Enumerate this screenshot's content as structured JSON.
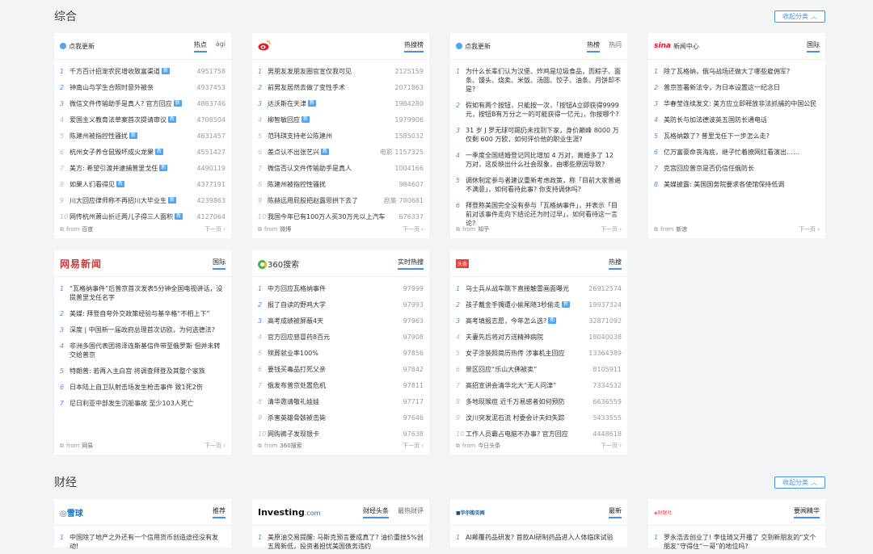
{
  "sections": {
    "zonghe": {
      "title": "综合",
      "collapse": "收起分类"
    },
    "caijing": {
      "title": "财经",
      "collapse": "收起分类"
    }
  },
  "common": {
    "from": "from",
    "next": "下一页",
    "new": "新"
  },
  "cards": {
    "c1": {
      "brand": "点我更新",
      "tabs": [
        "热点",
        "ági"
      ],
      "source": "百度",
      "items": [
        {
          "i": "1",
          "t": "千方百计招宠农民增收致富渠道",
          "new": true,
          "v": "4951758"
        },
        {
          "i": "2",
          "t": "钟南山与学生合照时意外被亲",
          "new": false,
          "v": "4937453"
        },
        {
          "i": "3",
          "t": "微信文件传输助手是真人? 官方回应",
          "new": true,
          "v": "4883746"
        },
        {
          "i": "4",
          "t": "爱国主义教育法草案首次提请审议",
          "new": true,
          "v": "4708504"
        },
        {
          "i": "5",
          "t": "陈建州被指控性骚扰",
          "new": true,
          "v": "4631457"
        },
        {
          "i": "6",
          "t": "杭州女子养仓鼠毁坏成火龙果",
          "new": true,
          "v": "4551427"
        },
        {
          "i": "7",
          "t": "美方: 希望引渡并逮捕普里戈任",
          "new": true,
          "v": "4490119"
        },
        {
          "i": "8",
          "t": "如果人们看得见",
          "new": true,
          "v": "4377191"
        },
        {
          "i": "9",
          "t": "川大回应律师称不再招川大毕业生",
          "new": true,
          "v": "4239863"
        },
        {
          "i": "10",
          "t": "网传杭州萧山折迁两儿子得三人面积",
          "new": true,
          "v": "4127064"
        }
      ]
    },
    "c2": {
      "brand": "",
      "tabs": [
        "热搜榜"
      ],
      "source": "微博",
      "items": [
        {
          "i": "1",
          "t": "男朋友发朋友圈官宣仅我可见",
          "new": false,
          "v": "2125159"
        },
        {
          "i": "2",
          "t": "前男友居然去做了变性手术",
          "new": false,
          "v": "2071863"
        },
        {
          "i": "3",
          "t": "达沃斯在天津",
          "new": true,
          "v": "1984280"
        },
        {
          "i": "4",
          "t": "柳智敏回应",
          "new": true,
          "v": "1979906"
        },
        {
          "i": "5",
          "t": "范玮琪支持老公陈建州",
          "new": false,
          "v": "1585032"
        },
        {
          "i": "6",
          "t": "差点认不出张艺兴",
          "new": true,
          "v": "电影 1157325"
        },
        {
          "i": "7",
          "t": "微信否认文件传输助手是真人",
          "new": false,
          "v": "1004166"
        },
        {
          "i": "8",
          "t": "陈建州被指控性骚扰",
          "new": false,
          "v": "984607"
        },
        {
          "i": "9",
          "t": "陈赫远用屁股把赵露思拱下去了",
          "new": false,
          "v": "剧集 780681"
        },
        {
          "i": "10",
          "t": "我国今年已有100万人买30万元以上汽车",
          "new": false,
          "v": "676337"
        }
      ]
    },
    "c3": {
      "brand": "点我更新",
      "tabs": [
        "热榜",
        "热问"
      ],
      "source": "知乎",
      "items": [
        {
          "i": "1",
          "t": "为什么长辈们认为汉堡、炸鸡是垃圾食品，而粽子、面条、馒头、烧卖、米饭、汤圆、饺子、油条、月饼却不是?"
        },
        {
          "i": "2",
          "t": "假如有两个按钮，只能按一次，「按钮A立即获得9999元，按钮B有万分之一的可能获得一亿元」，你按哪个?"
        },
        {
          "i": "3",
          "t": "31 岁 J 罗无球可踢仍未找到下家，身价巅峰 8000 万仅剩 600 万欧，如何评价他的职业生涯?"
        },
        {
          "i": "4",
          "t": "一季度全国结婚登记同比增加 4 万对，离婚多了 12 万对，这反映出什么社会现象，由哪些原因导致?"
        },
        {
          "i": "5",
          "t": "调休制定参与者建议重新考虑政策，称「目前大家普遍不满意」，如何看待此事? 你支持调休吗?"
        },
        {
          "i": "6",
          "t": "拜登称美国完全没有参与「瓦格纳事件」，并表示「目前对该事件走向下结论还为时过早」，如何看待这一言论?"
        }
      ]
    },
    "c4": {
      "brand": "新闻中心",
      "tabs": [
        "国际"
      ],
      "source": "新浪",
      "items": [
        {
          "i": "1",
          "t": "除了瓦格纳，俄乌战场还做大了哪些雇佣军?"
        },
        {
          "i": "2",
          "t": "普京签署新法令，为日本设置这一纪念日"
        },
        {
          "i": "3",
          "t": "华春莹连续发文: 美方应立即释放非法抓捕的中国公民"
        },
        {
          "i": "4",
          "t": "美防长与加法德波英五国防长通电话"
        },
        {
          "i": "5",
          "t": "瓦格纳散了? 普里戈任下一步怎么走?"
        },
        {
          "i": "6",
          "t": "亿万富豪命丧海底，继子忙着撩网红看演出……"
        },
        {
          "i": "7",
          "t": "克宫回应普京是否仍信任俄防长"
        },
        {
          "i": "8",
          "t": "美媒披露: 美国国务院要求各使馆保持低调"
        }
      ]
    },
    "c5": {
      "brand": "网易新闻",
      "tabs": [
        "国际"
      ],
      "source": "网易",
      "items": [
        {
          "i": "1",
          "t": "“瓦格纳事件”后普京首次发表5分钟全国电视讲话，没提普里戈任名字"
        },
        {
          "i": "2",
          "t": "美媒: 拜登自夸外交政策经验与基辛格“不相上下”"
        },
        {
          "i": "3",
          "t": "深度 | 中国新一届政府总理首次访欧，为何选德法?"
        },
        {
          "i": "4",
          "t": "非洲多国代表团将泽连斯基信件带至俄罗斯 但并未转交给普京"
        },
        {
          "i": "5",
          "t": "特朗普: 若再入主白宫 将调查拜登及其整个家族"
        },
        {
          "i": "6",
          "t": "日本陆上自卫队射击场发生枪击事件 致1死2伤"
        },
        {
          "i": "7",
          "t": "尼日利亚中部发生沉船事故 至少103人死亡"
        }
      ]
    },
    "c6": {
      "brand": "360搜索",
      "tabs": [
        "实时热搜"
      ],
      "source": "360搜索",
      "items": [
        {
          "i": "1",
          "t": "中方回应瓦格纳事件",
          "v": "97999"
        },
        {
          "i": "2",
          "t": "报了自读的野鸡大学",
          "v": "97993"
        },
        {
          "i": "3",
          "t": "高考成绩被屏蔽4天",
          "v": "97963"
        },
        {
          "i": "4",
          "t": "官方回应感冒药8百元",
          "v": "97908"
        },
        {
          "i": "5",
          "t": "殡葬就业率100%",
          "v": "97856"
        },
        {
          "i": "6",
          "t": "要钱买毒品打死父亲",
          "v": "97842"
        },
        {
          "i": "7",
          "t": "俄发布普京处置危机",
          "v": "97811"
        },
        {
          "i": "8",
          "t": "清华邀请敬礼娃娃",
          "v": "97717"
        },
        {
          "i": "9",
          "t": "杀害英雄骨骸被击毙",
          "v": "97646"
        },
        {
          "i": "10",
          "t": "网购裤子发现银卡",
          "v": "97638"
        }
      ]
    },
    "c7": {
      "brand": "头条",
      "tabs": [
        "热搜"
      ],
      "source": "今日头条",
      "items": [
        {
          "i": "1",
          "t": "乌士兵从战车跳下直接触雷画面曝光",
          "new": false,
          "v": "26912574"
        },
        {
          "i": "2",
          "t": "孩子戴金手镯遭小偷尾随3秒偷走",
          "new": true,
          "v": "19937324"
        },
        {
          "i": "3",
          "t": "高考填报志愿，今年怎么选?",
          "new": true,
          "v": "32871092"
        },
        {
          "i": "4",
          "t": "夫妻先后将对方送精神病院",
          "new": false,
          "v": "18040038"
        },
        {
          "i": "5",
          "t": "女子涂装照简历热传 涉事机主回应",
          "new": false,
          "v": "13364389"
        },
        {
          "i": "6",
          "t": "景区回应“乐山大佛被卖”",
          "new": false,
          "v": "8105911"
        },
        {
          "i": "7",
          "t": "高招宣讲会清华北大“无人问津”",
          "new": false,
          "v": "7334532"
        },
        {
          "i": "8",
          "t": "多地现猴痘 近千万易感者如何预防",
          "new": false,
          "v": "6636559"
        },
        {
          "i": "9",
          "t": "汶川突发泥石流 村委会计夫妇失踪",
          "new": false,
          "v": "5433555"
        },
        {
          "i": "10",
          "t": "工作人员霸占电脑不办事? 官方回应",
          "new": false,
          "v": "4448618"
        }
      ]
    },
    "f1": {
      "brand": "雪球",
      "tabs": [
        "推荐"
      ],
      "items": [
        {
          "i": "1",
          "t": "中国除了地产之外还有一个信用货币创造途径没有发动!"
        }
      ]
    },
    "f2": {
      "brand": "Investing",
      "brand2": ".com",
      "tabs": [
        "财经头条",
        "最热财评"
      ],
      "items": [
        {
          "i": "1",
          "t": "美原油交易提醒: 马斯克预言要成真了? 油价重挫5%创五周新低，投资者担忧美国债务违约"
        }
      ]
    },
    "f3": {
      "brand": "华尔街见闻",
      "tabs": [
        "最新"
      ],
      "items": [
        {
          "i": "1",
          "t": "AI颠覆药品研发? 首款AI研制药品进入人体临床试验"
        }
      ]
    },
    "f4": {
      "brand": "财联社",
      "tabs": [
        "要闻精华"
      ],
      "items": [
        {
          "i": "1",
          "t": "罗永浩去创业了! 李佳琦又开播了 交到新朋友的“文个朋友”守得住“一哥”的地位吗?"
        }
      ]
    }
  }
}
